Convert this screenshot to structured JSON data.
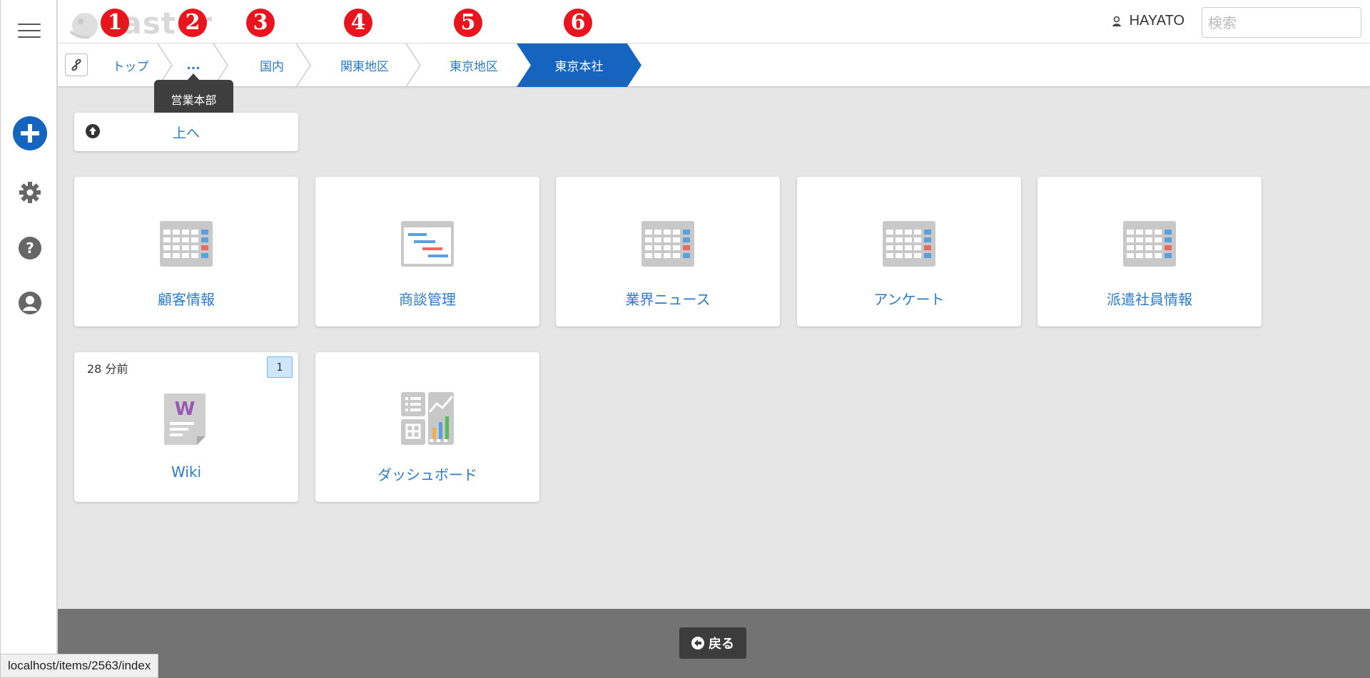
{
  "app": {
    "logo_text": "easter",
    "user_name": "HAYATO",
    "search_placeholder": "検索"
  },
  "markers": [
    "1",
    "2",
    "3",
    "4",
    "5",
    "6"
  ],
  "breadcrumb": {
    "items": [
      "トップ",
      "...",
      "国内",
      "関東地区",
      "東京地区",
      "東京本社"
    ],
    "active_index": 5,
    "tooltip": "営業本部"
  },
  "up_button": {
    "label": "上へ"
  },
  "cards": [
    {
      "title": "顧客情報",
      "icon": "table-icon"
    },
    {
      "title": "商談管理",
      "icon": "gantt-icon"
    },
    {
      "title": "業界ニュース",
      "icon": "table-icon"
    },
    {
      "title": "アンケート",
      "icon": "table-icon"
    },
    {
      "title": "派遣社員情報",
      "icon": "table-icon"
    },
    {
      "title": "Wiki",
      "icon": "wiki-icon",
      "time": "28 分前",
      "badge": "1"
    },
    {
      "title": "ダッシュボード",
      "icon": "dashboard-icon"
    }
  ],
  "footer": {
    "back_label": "戻る"
  },
  "status_bar": {
    "url": "localhost/items/2563/index"
  },
  "colors": {
    "accent": "#1565c0",
    "marker": "#e8141e",
    "link": "#2a7bc7"
  }
}
